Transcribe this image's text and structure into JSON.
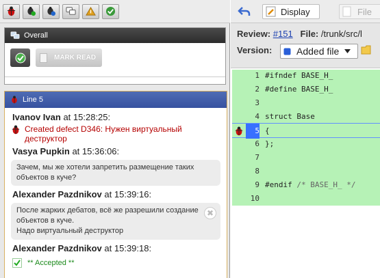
{
  "colors": {
    "panel_header_dark": "#333333",
    "panel_header_blue": "#3f5aa8",
    "code_added_bg": "#b6f2b6",
    "selected_line": "#3870ff",
    "defect_red": "#b50000",
    "accepted_green": "#1c8a1c"
  },
  "toolbar": {
    "buttons": [
      {
        "icon": "bug-icon"
      },
      {
        "icon": "bug-green-icon"
      },
      {
        "icon": "bug-blue-icon"
      },
      {
        "icon": "comments-icon"
      },
      {
        "icon": "warning-icon"
      },
      {
        "icon": "check-icon"
      }
    ]
  },
  "overall": {
    "title": "Overall",
    "mark_read_label": "MARK READ"
  },
  "line_panel": {
    "title": "Line 5",
    "messages": [
      {
        "author": "Ivanov Ivan",
        "at": "at",
        "time": "15:28:25:"
      },
      {
        "defect_text": "Created defect D346: Нужен виртуальный деструктор"
      },
      {
        "author": "Vasya Pupkin",
        "at": "at",
        "time": "15:36:06:",
        "body": "Зачем, мы же хотели запретить размещение таких объектов в куче?"
      },
      {
        "author": "Alexander Pazdnikov",
        "at": "at",
        "time": "15:39:16:",
        "body_lines": [
          "После жарких дебатов, всё же разрешили создание объектов в куче.",
          "Надо виртуальный деструктор"
        ]
      },
      {
        "author": "Alexander Pazdnikov",
        "at": "at",
        "time": "15:39:18:"
      },
      {
        "accepted_text": "** Accepted **"
      }
    ]
  },
  "right": {
    "tabs": {
      "display": "Display",
      "file": "File"
    },
    "review_label": "Review:",
    "review_link": "#151",
    "file_label": "File:",
    "file_path": "/trunk/src/l",
    "version_label": "Version:",
    "version_value": "Added file",
    "code_lines": [
      {
        "num": "1",
        "text": "#ifndef BASE_H_"
      },
      {
        "num": "2",
        "text": "#define BASE_H_"
      },
      {
        "num": "3",
        "text": ""
      },
      {
        "num": "4",
        "text": "struct Base"
      },
      {
        "num": "5",
        "text": "{",
        "selected": true,
        "marker": "bug-icon"
      },
      {
        "num": "6",
        "text": "};"
      },
      {
        "num": "7",
        "text": ""
      },
      {
        "num": "8",
        "text": ""
      },
      {
        "num": "9",
        "text": "#endif",
        "comment": "/* BASE_H_ */"
      },
      {
        "num": "10",
        "text": ""
      }
    ]
  }
}
